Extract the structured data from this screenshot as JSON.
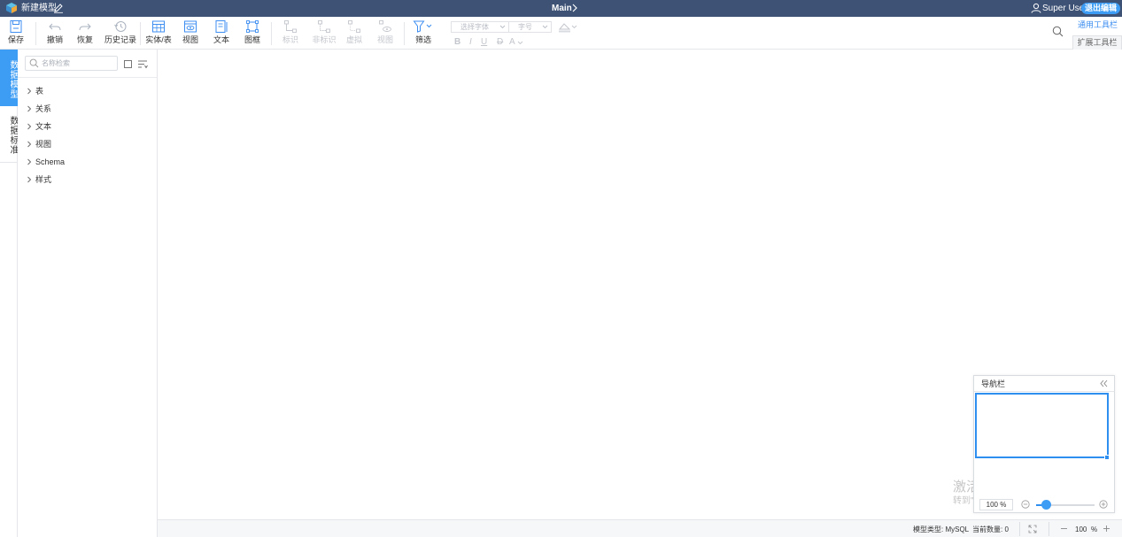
{
  "titlebar": {
    "model_name": "新建模型",
    "main_title": "Main",
    "user_name": "Super User",
    "exit_label": "退出编辑"
  },
  "toolbar": {
    "save": "保存",
    "undo": "撤销",
    "redo": "恢复",
    "history": "历史记录",
    "entity": "实体/表",
    "view": "视图",
    "text": "文本",
    "frame": "图框",
    "mark": "标识",
    "unmark": "非标识",
    "virtual": "虚拟",
    "view_rel": "视图",
    "filter": "筛选",
    "font_placeholder": "选择字体",
    "size_placeholder": "字号",
    "bold": "B",
    "italic": "I",
    "underline": "U",
    "strike": "D",
    "font_color": "A",
    "tab_general": "通用工具栏",
    "tab_extend": "扩展工具栏"
  },
  "vtabs": {
    "data_model": "数据模型",
    "data_standard": "数据标准"
  },
  "tree": {
    "search_placeholder": "名称检索",
    "items": [
      "表",
      "关系",
      "文本",
      "视图",
      "Schema",
      "样式"
    ]
  },
  "navigator": {
    "title": "导航栏",
    "zoom": "100 %",
    "zoom_level": 0.1
  },
  "watermark": {
    "line1": "激活 Windows",
    "line2": "转到\"设置\"以激活 Windows。"
  },
  "statusbar": {
    "model_type": "模型类型: MySQL",
    "count": "当前数量: 0",
    "zoom_value": "100",
    "zoom_unit": "%"
  },
  "colors": {
    "titlebar_bg": "#3d5275",
    "accent": "#3d9cf3"
  }
}
